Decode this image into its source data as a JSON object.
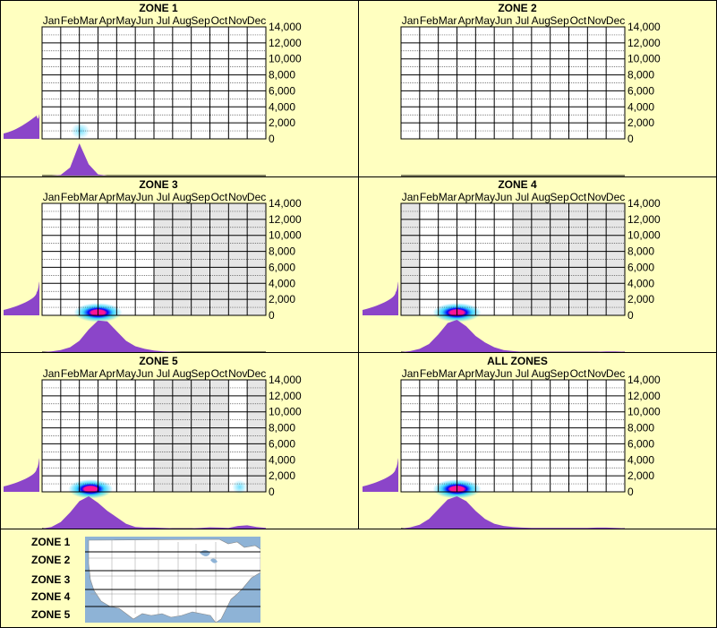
{
  "colors": {
    "background": "#ffffc0",
    "grid_line": "#000000",
    "dotted_line": "#555555",
    "inactive_fill": "#e6e6e6",
    "distribution_fill": "#8b45c9",
    "heat_peak": "#ff1493",
    "heat_mid": "#0000ff",
    "heat_low": "#00c8ff",
    "panel_border": "#000000",
    "map_water": "#8eb3d6",
    "map_land": "#ffffff"
  },
  "months": [
    "Jan",
    "Feb",
    "Mar",
    "Apr",
    "May",
    "Jun",
    "Jul",
    "Aug",
    "Sep",
    "Oct",
    "Nov",
    "Dec"
  ],
  "elevation_ticks": [
    "14,000",
    "12,000",
    "10,000",
    "8,000",
    "6,000",
    "4,000",
    "2,000",
    "0"
  ],
  "chart_data": [
    {
      "type": "heatmap",
      "title": "ZONE 1",
      "x_categories": [
        "Jan",
        "Feb",
        "Mar",
        "Apr",
        "May",
        "Jun",
        "Jul",
        "Aug",
        "Sep",
        "Oct",
        "Nov",
        "Dec"
      ],
      "ylim": [
        0,
        14000
      ],
      "inactive_months_shaded": false,
      "hotspots": [
        {
          "month": 2.05,
          "elevation": 1000,
          "intensity": 0.3,
          "spread_months": 0.5,
          "spread_elev": 1000
        }
      ],
      "month_distribution": [
        0,
        0,
        0.02,
        0.25,
        1.0,
        0.35,
        0.04,
        0,
        0,
        0,
        0,
        0,
        0,
        0,
        0,
        0,
        0,
        0,
        0,
        0,
        0,
        0,
        0,
        0,
        0
      ],
      "elevation_distribution": {
        "low": 0.35,
        "high": 0.9,
        "top_fraction": 0.22
      }
    },
    {
      "type": "heatmap",
      "title": "ZONE 2",
      "x_categories": [
        "Jan",
        "Feb",
        "Mar",
        "Apr",
        "May",
        "Jun",
        "Jul",
        "Aug",
        "Sep",
        "Oct",
        "Nov",
        "Dec"
      ],
      "ylim": [
        0,
        14000
      ],
      "inactive_months_shaded": false,
      "hotspots": [],
      "month_distribution": [],
      "elevation_distribution": null
    },
    {
      "type": "heatmap",
      "title": "ZONE 3",
      "x_categories": [
        "Jan",
        "Feb",
        "Mar",
        "Apr",
        "May",
        "Jun",
        "Jul",
        "Aug",
        "Sep",
        "Oct",
        "Nov",
        "Dec"
      ],
      "ylim": [
        0,
        14000
      ],
      "inactive_months_shaded": true,
      "active_months": [
        1,
        2,
        3,
        4,
        5,
        6
      ],
      "hotspots": [
        {
          "month": 3.0,
          "elevation": 350,
          "intensity": 1.0,
          "spread_months": 1.3,
          "spread_elev": 1200
        }
      ],
      "month_distribution": [
        0,
        0.02,
        0.06,
        0.15,
        0.35,
        0.7,
        0.98,
        0.95,
        0.65,
        0.35,
        0.18,
        0.1,
        0.05,
        0.02,
        0.01,
        0,
        0,
        0,
        0,
        0,
        0,
        0,
        0,
        0,
        0
      ],
      "elevation_distribution": {
        "low": 0.08,
        "high": 1.0,
        "top_fraction": 0.3
      }
    },
    {
      "type": "heatmap",
      "title": "ZONE 4",
      "x_categories": [
        "Jan",
        "Feb",
        "Mar",
        "Apr",
        "May",
        "Jun",
        "Jul",
        "Aug",
        "Sep",
        "Oct",
        "Nov",
        "Dec"
      ],
      "ylim": [
        0,
        14000
      ],
      "inactive_months_shaded": true,
      "active_months": [
        2,
        3,
        4,
        5,
        6
      ],
      "hotspots": [
        {
          "month": 3.0,
          "elevation": 350,
          "intensity": 1.0,
          "spread_months": 1.3,
          "spread_elev": 1200
        }
      ],
      "month_distribution": [
        0,
        0.03,
        0.1,
        0.25,
        0.55,
        0.9,
        1.0,
        0.8,
        0.5,
        0.3,
        0.15,
        0.06,
        0.03,
        0.01,
        0.01,
        0.01,
        0.01,
        0.01,
        0.01,
        0.01,
        0.01,
        0.01,
        0.02,
        0.02,
        0.01
      ],
      "elevation_distribution": {
        "low": 0.08,
        "high": 1.0,
        "top_fraction": 0.3
      }
    },
    {
      "type": "heatmap",
      "title": "ZONE 5",
      "x_categories": [
        "Jan",
        "Feb",
        "Mar",
        "Apr",
        "May",
        "Jun",
        "Jul",
        "Aug",
        "Sep",
        "Oct",
        "Nov",
        "Dec"
      ],
      "ylim": [
        0,
        14000
      ],
      "inactive_months_shaded": true,
      "active_months": [
        1,
        2,
        3,
        4,
        5,
        6,
        11
      ],
      "hotspots": [
        {
          "month": 2.6,
          "elevation": 350,
          "intensity": 1.0,
          "spread_months": 1.2,
          "spread_elev": 1200
        },
        {
          "month": 10.6,
          "elevation": 600,
          "intensity": 0.2,
          "spread_months": 0.4,
          "spread_elev": 900
        }
      ],
      "month_distribution": [
        0,
        0.05,
        0.2,
        0.5,
        0.85,
        1.0,
        0.8,
        0.55,
        0.35,
        0.15,
        0.05,
        0.03,
        0.03,
        0.02,
        0.01,
        0.01,
        0.01,
        0.02,
        0.04,
        0.03,
        0.02,
        0.08,
        0.1,
        0.05,
        0.02
      ],
      "elevation_distribution": {
        "low": 0.08,
        "high": 1.0,
        "top_fraction": 0.3
      }
    },
    {
      "type": "heatmap",
      "title": "ALL ZONES",
      "x_categories": [
        "Jan",
        "Feb",
        "Mar",
        "Apr",
        "May",
        "Jun",
        "Jul",
        "Aug",
        "Sep",
        "Oct",
        "Nov",
        "Dec"
      ],
      "ylim": [
        0,
        14000
      ],
      "inactive_months_shaded": true,
      "active_months": [
        1,
        2,
        3,
        4,
        5,
        6,
        7,
        8,
        9,
        10,
        11,
        12
      ],
      "hotspots": [
        {
          "month": 3.0,
          "elevation": 350,
          "intensity": 1.0,
          "spread_months": 1.3,
          "spread_elev": 1200
        }
      ],
      "month_distribution": [
        0,
        0.04,
        0.12,
        0.3,
        0.6,
        0.9,
        1.0,
        0.85,
        0.55,
        0.3,
        0.15,
        0.08,
        0.05,
        0.03,
        0.02,
        0.02,
        0.02,
        0.02,
        0.02,
        0.02,
        0.02,
        0.03,
        0.03,
        0.02,
        0.01
      ],
      "elevation_distribution": {
        "low": 0.08,
        "high": 1.0,
        "top_fraction": 0.3
      }
    }
  ],
  "zone_legend": {
    "labels": [
      "ZONE 1",
      "ZONE 2",
      "ZONE 3",
      "ZONE 4",
      "ZONE 5"
    ]
  }
}
